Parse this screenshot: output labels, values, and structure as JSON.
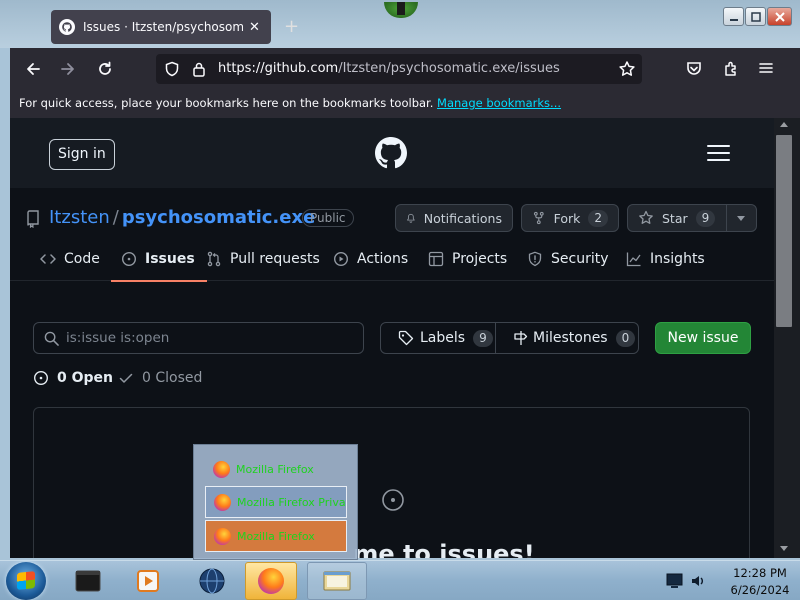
{
  "browser": {
    "tab_title": "Issues · Itzsten/psychosomatic.exe",
    "url_host": "https://github.com",
    "url_path": "/Itzsten/psychosomatic.exe/issues",
    "bookmarks_text": "For quick access, place your bookmarks here on the bookmarks toolbar.",
    "bookmarks_link": "Manage bookmarks..."
  },
  "github": {
    "sign_in": "Sign in",
    "owner": "Itzsten",
    "separator": "/",
    "repo": "psychosomatic.exe",
    "visibility": "Public",
    "notifications": "Notifications",
    "fork_label": "Fork",
    "fork_count": "2",
    "star_label": "Star",
    "star_count": "9",
    "tabs": [
      {
        "label": "Code"
      },
      {
        "label": "Issues"
      },
      {
        "label": "Pull requests"
      },
      {
        "label": "Actions"
      },
      {
        "label": "Projects"
      },
      {
        "label": "Security"
      },
      {
        "label": "Insights"
      }
    ],
    "search_value": "is:issue is:open",
    "labels_label": "Labels",
    "labels_count": "9",
    "milestones_label": "Milestones",
    "milestones_count": "0",
    "new_issue": "New issue",
    "open_state": "0 Open",
    "closed_state": "0 Closed",
    "blankslate_title": "me to issues!"
  },
  "popup": {
    "items": [
      {
        "label": "Mozilla Firefox"
      },
      {
        "label": "Mozilla Firefox Private"
      },
      {
        "label": "Mozilla Firefox"
      }
    ]
  },
  "taskbar": {
    "time": "12:28 PM",
    "date": "6/26/2024"
  },
  "colors": {
    "accent_link": "#4493f8",
    "new_issue_green": "#238636",
    "tab_underline": "#f78166",
    "page_bg": "#0d1117"
  }
}
